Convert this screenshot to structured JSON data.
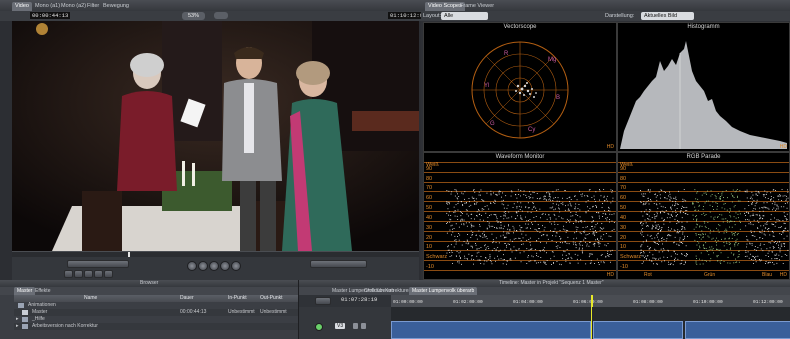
{
  "viewer": {
    "tabs": [
      "Video",
      "Mono (a1)",
      "Mono (a2)",
      "Filter",
      "Bewegung"
    ],
    "timecode_left": "00:00:44:13",
    "zoom": "53%",
    "timecode_right": "01:10:12:09"
  },
  "scopes": {
    "tabs": [
      "Video Scopes",
      "Frame Viewer"
    ],
    "layout_label": "Layout:",
    "layout_value": "Alle",
    "display_label": "Darstellung:",
    "display_value": "Aktuelles Bild",
    "vectorscope": {
      "title": "Vectorscope",
      "targets": [
        "R",
        "Mg",
        "B",
        "Cy",
        "G",
        "Yl"
      ],
      "corner_label": "HD"
    },
    "histogram": {
      "title": "Histogramm",
      "corner_label": "HD"
    },
    "waveform": {
      "title": "Waveform Monitor",
      "scale": [
        "Weiß",
        "90",
        "80",
        "70",
        "60",
        "50",
        "40",
        "30",
        "20",
        "10",
        "Schwarz",
        "-10"
      ],
      "corner_label": "HD"
    },
    "parade": {
      "title": "RGB Parade",
      "scale": [
        "Weiß",
        "90",
        "80",
        "70",
        "60",
        "50",
        "40",
        "30",
        "20",
        "10",
        "Schwarz",
        "-10"
      ],
      "channels": [
        "Rot",
        "Grün",
        "Blau"
      ],
      "corner_label": "HD"
    }
  },
  "browser": {
    "title": "Browser",
    "tabs": [
      "Master",
      "Effekte"
    ],
    "columns": [
      "Name",
      "Dauer",
      "In-Punkt",
      "Out-Punkt"
    ],
    "rows": [
      {
        "name": "Animationen",
        "dauer": "",
        "in": "",
        "out": ""
      },
      {
        "name": "Master",
        "dauer": "00:00:44:13",
        "in": "Unbestimmt",
        "out": "Unbestimmt"
      },
      {
        "name": "_Hilfe",
        "dauer": "",
        "in": "",
        "out": ""
      },
      {
        "name": "Arbeitsversion nach Korrektur",
        "dauer": "",
        "in": "",
        "out": ""
      }
    ]
  },
  "timeline": {
    "title": "Timeline: Master in Projekt \"Sequenz 1 Master\"",
    "tabs": [
      "Master Lumpenvolk überarb",
      "Christian Korrekturen",
      "Master Lumpenvolk überarb"
    ],
    "current_timecode": "01:07:28:19",
    "ruler": [
      "01:00:00:00",
      "01:02:00:00",
      "01:04:00:00",
      "01:06:00:00",
      "01:08:00:00",
      "01:10:00:00",
      "01:12:00:00",
      "01:14:00:00"
    ],
    "track_label": "V3"
  },
  "colors": {
    "scope_grid": "#b45f12",
    "scope_text": "#e08a2a",
    "selection_blue": "#3a5f9a",
    "panel_gray": "#3b3e44"
  }
}
